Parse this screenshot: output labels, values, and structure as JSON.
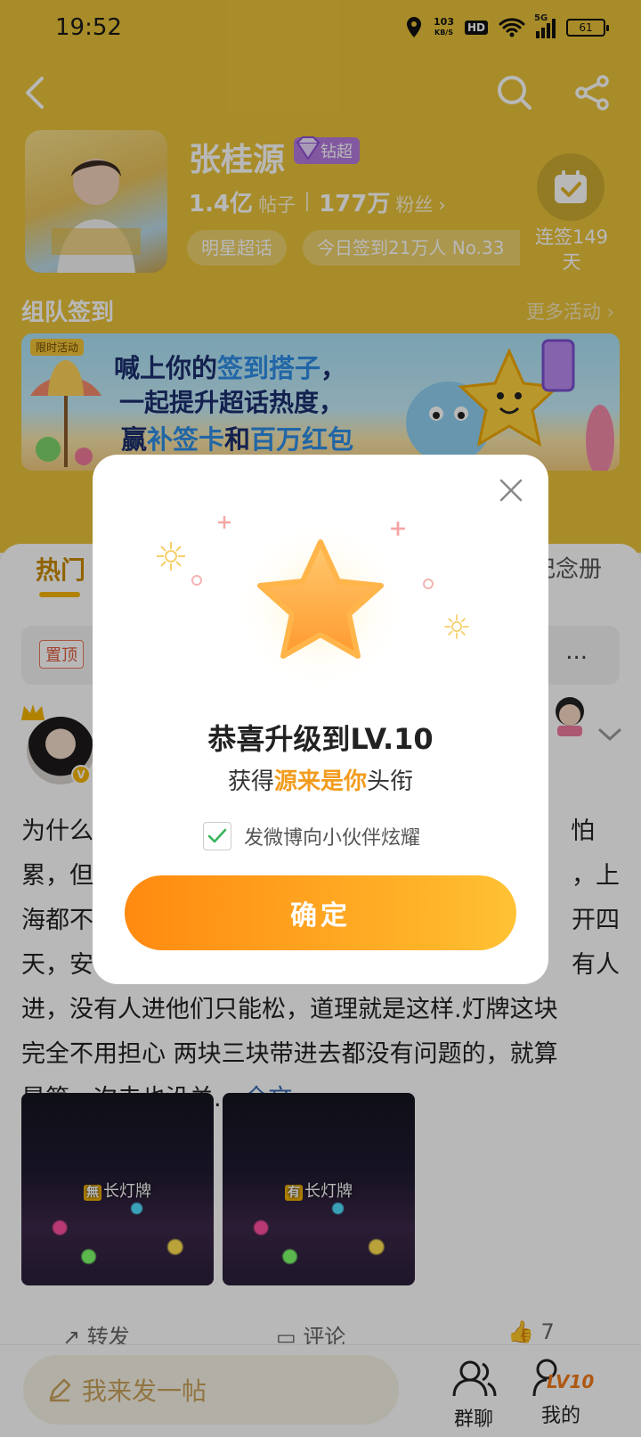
{
  "status": {
    "time": "19:52",
    "speed_value": "103",
    "speed_unit": "KB/S",
    "hd": "HD",
    "network": "5G",
    "battery": "61"
  },
  "topic": {
    "name": "张桂源",
    "badge": "钻超",
    "posts_count": "1.4亿",
    "posts_label": "帖子",
    "fans_count": "177万",
    "fans_label": "粉丝",
    "chip_category": "明星超话",
    "chip_checkin": "今日签到21万人 No.33",
    "checkin_streak_line1": "连签149",
    "checkin_streak_line2": "天"
  },
  "team_section": {
    "title": "组队签到",
    "more": "更多活动"
  },
  "banner": {
    "tag": "限时活动",
    "line1_a": "喊上你的",
    "line1_b": "签到搭子",
    "line1_c": "，",
    "line2": "一起提升超话热度，",
    "line3_a": "赢",
    "line3_b": "补签卡",
    "line3_c": "和",
    "line3_d": "百万红包"
  },
  "tabs": {
    "hot": "热门",
    "album_partial": "纪念册"
  },
  "pinned": {
    "tag": "置顶",
    "more": "..."
  },
  "post": {
    "lines": [
      "为什么",
      "怕",
      "累，但",
      "，上",
      "海都不",
      "开四",
      "天，安",
      "有人",
      "进，没有人进他们只能松，道理就是这样.灯牌这块",
      "完全不用担心 两块三块带进去都没有问题的，就算",
      "是第一次去也没关..."
    ],
    "full_text": "全文",
    "thumb1_tag": "無",
    "thumb1_caption": "长灯牌",
    "thumb2_tag": "有",
    "thumb2_caption": "长灯牌",
    "action_forward": "转发",
    "action_comment": "评论",
    "action_like": "7"
  },
  "bottom": {
    "compose": "我来发一帖",
    "group_chat": "群聊",
    "mine": "我的",
    "level_badge": "LV10"
  },
  "modal": {
    "title": "恭喜升级到LV.10",
    "sub_before": "获得",
    "sub_highlight": "源来是你",
    "sub_after": "头衔",
    "checkbox_label": "发微博向小伙伴炫耀",
    "checkbox_checked": true,
    "confirm": "确定"
  },
  "colors": {
    "header": "#e9c33a",
    "accent": "#f5b400",
    "button_start": "#ff8a10",
    "button_end": "#ffc235"
  }
}
